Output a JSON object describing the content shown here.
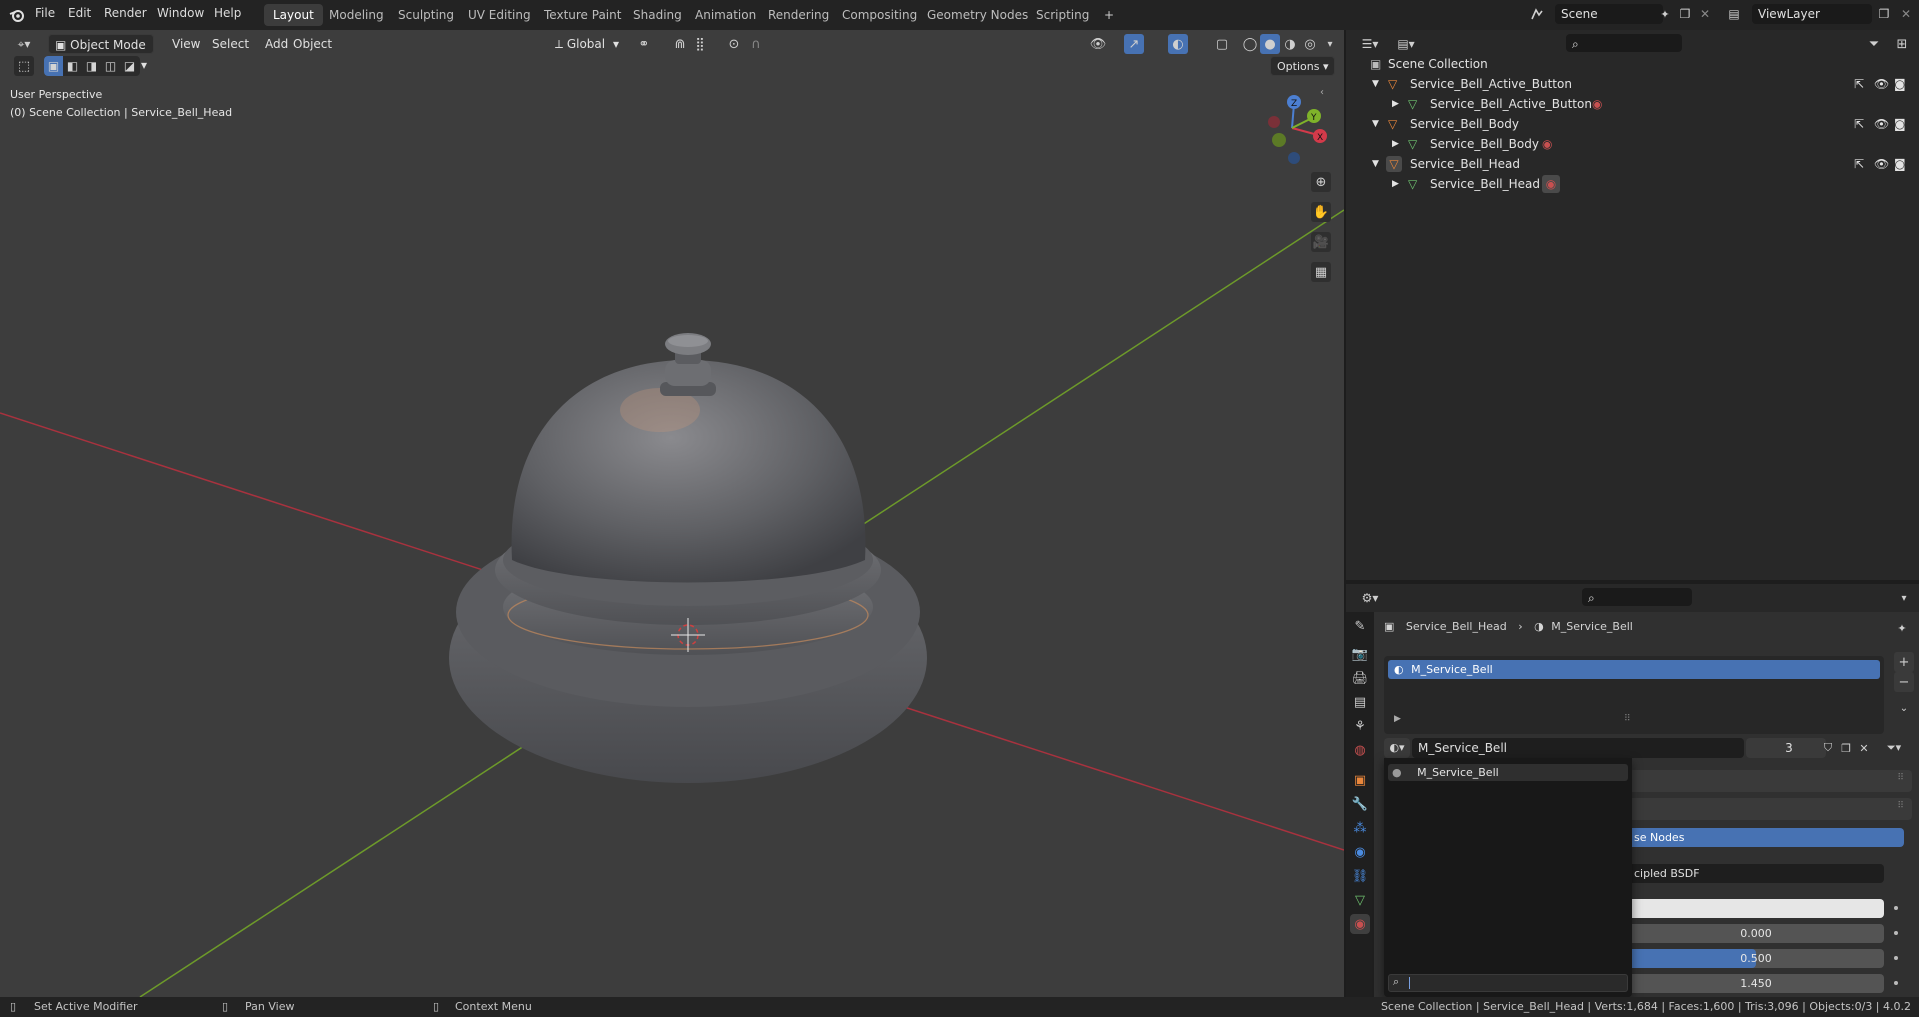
{
  "topbar": {
    "menus": [
      "File",
      "Edit",
      "Render",
      "Window",
      "Help"
    ],
    "workspaces": [
      "Layout",
      "Modeling",
      "Sculpting",
      "UV Editing",
      "Texture Paint",
      "Shading",
      "Animation",
      "Rendering",
      "Compositing",
      "Geometry Nodes",
      "Scripting"
    ],
    "active_workspace": "Layout",
    "add_tab": "+",
    "scene": "Scene",
    "view_layer": "ViewLayer"
  },
  "viewport": {
    "mode": "Object Mode",
    "menus": [
      "View",
      "Select",
      "Add",
      "Object"
    ],
    "orientation": "Global",
    "options_label": "Options",
    "overlay_title": "User Perspective",
    "overlay_context": "(0) Scene Collection | Service_Bell_Head",
    "gizmo": {
      "x": "X",
      "y": "Y",
      "z": "Z"
    }
  },
  "outliner": {
    "root": "Scene Collection",
    "items": [
      {
        "name": "Service_Bell_Active_Button",
        "child": "Service_Bell_Active_Button"
      },
      {
        "name": "Service_Bell_Body",
        "child": "Service_Bell_Body"
      },
      {
        "name": "Service_Bell_Head",
        "child": "Service_Bell_Head"
      }
    ]
  },
  "properties": {
    "breadcrumb_object": "Service_Bell_Head",
    "breadcrumb_material": "M_Service_Bell",
    "slot_name": "M_Service_Bell",
    "material_name": "M_Service_Bell",
    "user_count": "3",
    "dropdown_item": "M_Service_Bell",
    "use_nodes_partial": "se Nodes",
    "surface_partial": "cipled BSDF",
    "values": [
      "0.000",
      "0.500",
      "1.450"
    ],
    "progress": {
      "metallic": 0.0,
      "roughness": 0.5
    }
  },
  "statusbar": {
    "left": [
      "Set Active Modifier",
      "Pan View",
      "Context Menu"
    ],
    "right": "Scene Collection | Service_Bell_Head | Verts:1,684 | Faces:1,600 | Tris:3,096 | Objects:0/3 | 4.0.2"
  },
  "colors": {
    "accent": "#4772b3",
    "orange": "#e8863b",
    "axis_x": "#a8323e",
    "axis_y": "#6d9a2a"
  }
}
